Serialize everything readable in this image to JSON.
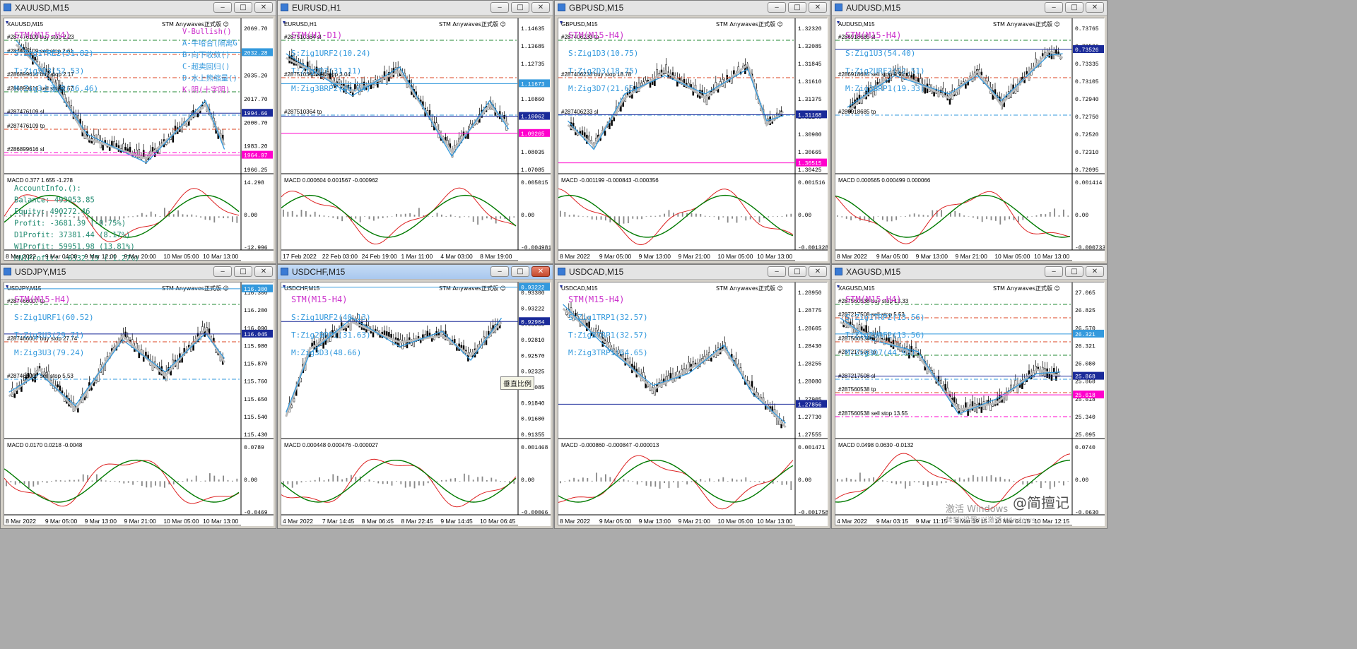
{
  "colors": {
    "bull": "#cc33cc",
    "blue": "#3399dd",
    "trend_gray": "#bbbbbb",
    "bid": "#1a2a99",
    "ask": "#d40000",
    "macd_green": "#007a00",
    "macd_red": "#dd2222",
    "order_green": "#228833",
    "order_red": "#dd4422",
    "magenta": "#ff00cc"
  },
  "windows": [
    {
      "title": "XAUUSD,M15",
      "inner": "XAUUSD,M15",
      "active": false,
      "indicator": "STM Anywaves正式版 ☺",
      "scale": [
        "2069.70",
        "2052.70",
        "2035.20",
        "2017.70",
        "2000.70",
        "1983.20",
        "1966.25",
        "14.298",
        "0.00",
        "-12.996"
      ],
      "price_tags": [
        {
          "text": "2032.28",
          "level": 0.22,
          "color": "#3399dd"
        },
        {
          "text": "1994.66",
          "level": 0.61,
          "color": "#1a2a99"
        },
        {
          "text": "1964.97",
          "level": 0.88,
          "color": "#ff00cc"
        }
      ],
      "labels": [
        {
          "text": "STM(M15-H4)",
          "color": "#cc33cc",
          "size": 12
        },
        {
          "text": "S:Zig1TRE2(51.82)",
          "color": "#3399dd",
          "size": 11
        },
        {
          "text": "T:Zig2D3(52.53)",
          "color": "#3399dd",
          "size": 11
        },
        {
          "text": "M:Zig3上涨浪(36.46)",
          "color": "#3399dd",
          "size": 11
        }
      ],
      "side_text": [
        {
          "text": "V-Bullish()",
          "color": "#cc33cc"
        },
        {
          "text": "A-牛哈合(隔离G",
          "color": "#3399dd"
        },
        {
          "text": "B-向下收敛()",
          "color": "#3399dd"
        },
        {
          "text": "C-超卖回归()",
          "color": "#3399dd"
        },
        {
          "text": "D-水上熊缩量()",
          "color": "#3399dd"
        },
        {
          "text": "K-阴(十字阴)",
          "color": "#cc33cc"
        }
      ],
      "orders": [
        "#287476109 buy stop 2.23",
        "#286899616 buy stop 2.17",
        "#287476109 sl",
        "#286899616 sl",
        "#287476109 sell stop 2.61",
        "#286899616 sell stop 2.57",
        "#287476109 tp"
      ],
      "macd": "MACD 0.377 1.655 -1.278",
      "account": [
        "AccountInfo.():",
        "Balance: 493953.85",
        "Equity: 490272.46",
        "Profit: -3681.39 (-0.75%)",
        "D1Profit: 37381.44 (8.17%)",
        "W1Profit: 59951.98 (13.81%)",
        "MN1Profit: -6332.15 (-1.27%)"
      ],
      "xaxis": [
        "8 Mar 2022",
        "9 Mar 04:00",
        "9 Mar 12:00",
        "9 Mar 20:00",
        "10 Mar 05:00",
        "10 Mar 13:00"
      ]
    },
    {
      "title": "EURUSD,H1",
      "inner": "EURUSD,H1",
      "active": false,
      "indicator": "STM Anywaves正式版 ☺",
      "scale": [
        "1.14635",
        "1.13685",
        "1.12735",
        "1.11785",
        "1.10860",
        "1.09860",
        "1.08960",
        "1.08035",
        "1.07085",
        "0.005015",
        "0.00",
        "-0.004981"
      ],
      "price_tags": [
        {
          "text": "1.11673",
          "level": 0.42,
          "color": "#3399dd"
        },
        {
          "text": "1.10062",
          "level": 0.63,
          "color": "#1a2a99"
        },
        {
          "text": "1.09265",
          "level": 0.74,
          "color": "#ff00cc"
        }
      ],
      "labels": [
        {
          "text": "STM(H1-D1)",
          "color": "#cc33cc",
          "size": 12
        },
        {
          "text": "S:Zig1URF2(10.24)",
          "color": "#3399dd",
          "size": 11
        },
        {
          "text": "T:Zig2D7(31.11)",
          "color": "#3399dd",
          "size": 11
        },
        {
          "text": "M:Zig3BRP2(46.64)",
          "color": "#3399dd",
          "size": 11
        }
      ],
      "side_text": [],
      "orders": [
        "#287510364 sl",
        "#287510364 sell stop 3.04",
        "#287510364 tp"
      ],
      "macd": "MACD 0.000604 0.001567 -0.000962",
      "account": [],
      "xaxis": [
        "17 Feb 2022",
        "22 Feb 03:00",
        "24 Feb 19:00",
        "1 Mar 11:00",
        "4 Mar 03:00",
        "8 Mar 19:00"
      ]
    },
    {
      "title": "GBPUSD,M15",
      "inner": "GBPUSD,M15",
      "active": false,
      "indicator": "STM Anywaves正式版 ☺",
      "scale": [
        "1.32320",
        "1.32085",
        "1.31845",
        "1.31610",
        "1.31375",
        "1.31140",
        "1.30900",
        "1.30665",
        "1.30425",
        "0.001516",
        "0.00",
        "-0.001328"
      ],
      "price_tags": [
        {
          "text": "1.31168",
          "level": 0.62,
          "color": "#1a2a99"
        },
        {
          "text": "1.30515",
          "level": 0.93,
          "color": "#ff00cc"
        }
      ],
      "labels": [
        {
          "text": "STM(M15-H4)",
          "color": "#cc33cc",
          "size": 12
        },
        {
          "text": "S:Zig1D3(10.75)",
          "color": "#3399dd",
          "size": 11
        },
        {
          "text": "T:Zig2D3(18.75)",
          "color": "#3399dd",
          "size": 11
        },
        {
          "text": "M:Zig3D7(21.65)",
          "color": "#3399dd",
          "size": 11
        }
      ],
      "side_text": [],
      "orders": [
        "#287406233 tp",
        "#287406233 buy stop 18.78",
        "#287406233 sl"
      ],
      "macd": "MACD -0.001199 -0.000843 -0.000356",
      "account": [],
      "xaxis": [
        "8 Mar 2022",
        "9 Mar 05:00",
        "9 Mar 13:00",
        "9 Mar 21:00",
        "10 Mar 05:00",
        "10 Mar 13:00"
      ]
    },
    {
      "title": "AUDUSD,M15",
      "inner": "AUDUSD,M15",
      "active": false,
      "indicator": "STM Anywaves正式版 ☺",
      "scale": [
        "0.73765",
        "0.73526",
        "0.73335",
        "0.73105",
        "0.72940",
        "0.72750",
        "0.72520",
        "0.72310",
        "0.72095",
        "0.001414",
        "0.00",
        "-0.000733"
      ],
      "price_tags": [
        {
          "text": "0.73526",
          "level": 0.2,
          "color": "#1a2a99"
        }
      ],
      "labels": [
        {
          "text": "STM(M15-H4)",
          "color": "#cc33cc",
          "size": 12
        },
        {
          "text": "S:Zig1U3(54.40)",
          "color": "#3399dd",
          "size": 11
        },
        {
          "text": "T:Zig2URF2(22.51)",
          "color": "#3399dd",
          "size": 11
        },
        {
          "text": "M:Zig3BRP1(19.33)",
          "color": "#3399dd",
          "size": 11
        }
      ],
      "side_text": [],
      "orders": [
        "#286918685 sl",
        "#286918685 sell stop 9.91",
        "#286918685 tp"
      ],
      "macd": "MACD 0.000565 0.000499 0.000066",
      "account": [],
      "xaxis": [
        "8 Mar 2022",
        "9 Mar 05:00",
        "9 Mar 13:00",
        "9 Mar 21:00",
        "10 Mar 05:00",
        "10 Mar 13:00"
      ]
    },
    {
      "title": "USDJPY,M15",
      "inner": "USDJPY,M15",
      "active": false,
      "indicator": "STM Anywaves正式版 ☺",
      "scale": [
        "116.300",
        "116.200",
        "116.090",
        "115.980",
        "115.870",
        "115.760",
        "115.650",
        "115.540",
        "115.430",
        "0.0789",
        "0.00",
        "-0.0469"
      ],
      "price_tags": [
        {
          "text": "116.300",
          "level": 0.04,
          "color": "#3399dd"
        },
        {
          "text": "116.045",
          "level": 0.33,
          "color": "#1a2a99"
        }
      ],
      "labels": [
        {
          "text": "STM(M15-H4)",
          "color": "#cc33cc",
          "size": 12
        },
        {
          "text": "S:Zig1URF1(60.52)",
          "color": "#3399dd",
          "size": 11
        },
        {
          "text": "T:Zig2U3(29.71)",
          "color": "#3399dd",
          "size": 11
        },
        {
          "text": "M:Zig3U3(79.24)",
          "color": "#3399dd",
          "size": 11
        }
      ],
      "side_text": [],
      "orders": [
        "#287466007 tp",
        "#287466007 buy stop 27.74",
        "#287466007 sell stop 5.53"
      ],
      "macd": "MACD 0.0170 0.0218 -0.0048",
      "account": [],
      "xaxis": [
        "8 Mar 2022",
        "9 Mar 05:00",
        "9 Mar 13:00",
        "9 Mar 21:00",
        "10 Mar 05:00",
        "10 Mar 13:00"
      ]
    },
    {
      "title": "USDCHF,M15",
      "inner": "USDCHF,M15",
      "active": true,
      "indicator": "STM Anywaves正式版 ☺",
      "scale": [
        "0.93300",
        "0.93222",
        "0.93055",
        "0.92810",
        "0.92570",
        "0.92325",
        "0.92085",
        "0.91840",
        "0.91600",
        "0.91355",
        "0.001468",
        "0.00",
        "-0.00066"
      ],
      "price_tags": [
        {
          "text": "0.93222",
          "level": 0.03,
          "color": "#3399dd"
        },
        {
          "text": "0.92904",
          "level": 0.25,
          "color": "#1a2a99"
        }
      ],
      "labels": [
        {
          "text": "STM(M15-H4)",
          "color": "#cc33cc",
          "size": 12
        },
        {
          "text": "S:Zig1URF2(40.13)",
          "color": "#3399dd",
          "size": 11
        },
        {
          "text": "T:Zig2BRP1(31.63)",
          "color": "#3399dd",
          "size": 11
        },
        {
          "text": "M:Zig3D3(48.66)",
          "color": "#3399dd",
          "size": 11
        }
      ],
      "side_text": [],
      "orders": [],
      "macd": "MACD 0.000448 0.000476 -0.000027",
      "account": [],
      "xaxis": [
        "4 Mar 2022",
        "7 Mar 14:45",
        "8 Mar 06:45",
        "8 Mar 22:45",
        "9 Mar 14:45",
        "10 Mar 06:45"
      ],
      "tooltip": "垂直比例"
    },
    {
      "title": "USDCAD,M15",
      "inner": "USDCAD,M15",
      "active": false,
      "indicator": "STM Anywaves正式版 ☺",
      "scale": [
        "1.28950",
        "1.28775",
        "1.28605",
        "1.28430",
        "1.28255",
        "1.28080",
        "1.27905",
        "1.27730",
        "1.27555",
        "0.001471",
        "0.00",
        "-0.001758"
      ],
      "price_tags": [
        {
          "text": "1.27856",
          "level": 0.78,
          "color": "#1a2a99"
        }
      ],
      "labels": [
        {
          "text": "STM(M15-H4)",
          "color": "#cc33cc",
          "size": 12
        },
        {
          "text": "S:Zig1TRP1(32.57)",
          "color": "#3399dd",
          "size": 11
        },
        {
          "text": "T:Zig2TRP1(32.57)",
          "color": "#3399dd",
          "size": 11
        },
        {
          "text": "M:Zig3TRP1(64.65)",
          "color": "#3399dd",
          "size": 11
        }
      ],
      "side_text": [],
      "orders": [],
      "macd": "MACD -0.000860 -0.000847 -0.000013",
      "account": [],
      "xaxis": [
        "8 Mar 2022",
        "9 Mar 05:00",
        "9 Mar 13:00",
        "9 Mar 21:00",
        "10 Mar 05:00",
        "10 Mar 13:00"
      ]
    },
    {
      "title": "XAGUSD,M15",
      "inner": "XAGUSD,M15",
      "active": false,
      "indicator": "STM Anywaves正式版 ☺",
      "scale": [
        "27.065",
        "26.825",
        "26.570",
        "26.321",
        "26.080",
        "25.868",
        "25.618",
        "25.340",
        "25.095",
        "0.0740",
        "0.00",
        "-0.0630"
      ],
      "price_tags": [
        {
          "text": "26.321",
          "level": 0.33,
          "color": "#3399dd"
        },
        {
          "text": "25.868",
          "level": 0.6,
          "color": "#1a2a99"
        },
        {
          "text": "25.618",
          "level": 0.72,
          "color": "#ff00cc"
        }
      ],
      "labels": [
        {
          "text": "STM(M15-H4)",
          "color": "#cc33cc",
          "size": 12
        },
        {
          "text": "S:Zig1TRP2(13.56)",
          "color": "#3399dd",
          "size": 11
        },
        {
          "text": "T:Zig2URF2(13.56)",
          "color": "#3399dd",
          "size": 11
        },
        {
          "text": "M:Zig3D7(44.93)",
          "color": "#3399dd",
          "size": 11
        }
      ],
      "side_text": [],
      "orders": [
        "#287560538 buy stop 13.33",
        "#287560538 sl",
        "#287217508 sl",
        "#287560538 sell stop 13.55",
        "#287217508 sell stop 5.53",
        "#287217508 tp",
        "#287560538 tp"
      ],
      "macd": "MACD 0.0498 0.0630 -0.0132",
      "account": [],
      "xaxis": [
        "4 Mar 2022",
        "9 Mar 03:15",
        "9 Mar 11:15",
        "9 Mar 19:15",
        "10 Mar 04:15",
        "10 Mar 12:15"
      ],
      "watermark": "@简擅记",
      "activate": [
        "激活 Windows",
        "转到\"设置\"以激活 Windows。"
      ]
    }
  ]
}
